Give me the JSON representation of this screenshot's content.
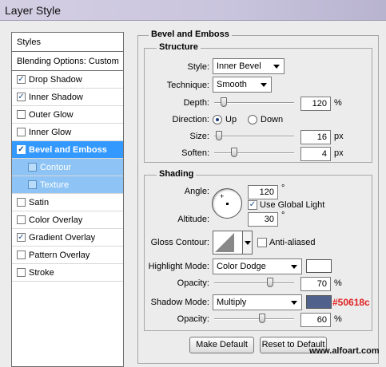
{
  "window": {
    "title": "Layer Style"
  },
  "styles_list": {
    "header": "Styles",
    "blending": "Blending Options: Custom",
    "items": [
      {
        "label": "Drop Shadow",
        "checked": true
      },
      {
        "label": "Inner Shadow",
        "checked": true
      },
      {
        "label": "Outer Glow",
        "checked": false
      },
      {
        "label": "Inner Glow",
        "checked": false
      },
      {
        "label": "Bevel and Emboss",
        "checked": true,
        "selected": true
      },
      {
        "label": "Contour",
        "checked": false,
        "sub": true
      },
      {
        "label": "Texture",
        "checked": false,
        "sub": true
      },
      {
        "label": "Satin",
        "checked": false
      },
      {
        "label": "Color Overlay",
        "checked": false
      },
      {
        "label": "Gradient Overlay",
        "checked": true
      },
      {
        "label": "Pattern Overlay",
        "checked": false
      },
      {
        "label": "Stroke",
        "checked": false
      }
    ]
  },
  "bevel": {
    "title": "Bevel and Emboss",
    "structure": {
      "title": "Structure",
      "style_label": "Style:",
      "style_value": "Inner Bevel",
      "technique_label": "Technique:",
      "technique_value": "Smooth",
      "depth_label": "Depth:",
      "depth_value": "120",
      "depth_unit": "%",
      "depth_slider": 0.12,
      "direction_label": "Direction:",
      "dir_up": "Up",
      "dir_down": "Down",
      "direction": "Up",
      "size_label": "Size:",
      "size_value": "16",
      "size_unit": "px",
      "size_slider": 0.06,
      "soften_label": "Soften:",
      "soften_value": "4",
      "soften_unit": "px",
      "soften_slider": 0.25
    },
    "shading": {
      "title": "Shading",
      "angle_label": "Angle:",
      "angle_value": "120",
      "angle_unit": "°",
      "global_light_label": "Use Global Light",
      "global_light": true,
      "altitude_label": "Altitude:",
      "altitude_value": "30",
      "altitude_unit": "°",
      "gloss_label": "Gloss Contour:",
      "anti_aliased_label": "Anti-aliased",
      "anti_aliased": false,
      "highlight_label": "Highlight Mode:",
      "highlight_mode": "Color Dodge",
      "highlight_color": "#ffffff",
      "hl_opacity_label": "Opacity:",
      "hl_opacity_value": "70",
      "hl_opacity_unit": "%",
      "hl_opacity_slider": 0.7,
      "shadow_label": "Shadow Mode:",
      "shadow_mode": "Multiply",
      "shadow_color": "#50618c",
      "sh_opacity_label": "Opacity:",
      "sh_opacity_value": "60",
      "sh_opacity_unit": "%",
      "sh_opacity_slider": 0.6
    },
    "make_default": "Make Default",
    "reset_default": "Reset to Default"
  },
  "annotation": "#50618c",
  "watermark": "www.alfoart.com"
}
